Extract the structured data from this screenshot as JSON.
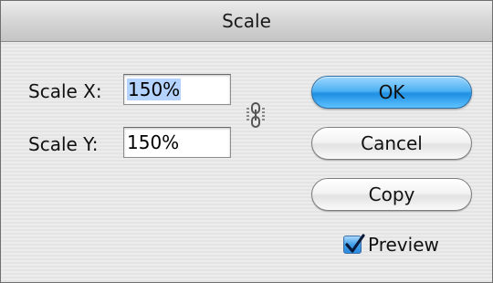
{
  "window": {
    "title": "Scale"
  },
  "scale_x": {
    "label": "Scale X:",
    "value": "150%",
    "selected": true
  },
  "scale_y": {
    "label": "Scale Y:",
    "value": "150%"
  },
  "buttons": {
    "ok": "OK",
    "cancel": "Cancel",
    "copy": "Copy"
  },
  "preview": {
    "label": "Preview",
    "checked": true
  },
  "icons": {
    "constrain": "chain-link-icon",
    "checkmark": "checkmark-icon"
  },
  "colors": {
    "default_button": "#4fb2f3",
    "selection": "#b5d3ff"
  }
}
